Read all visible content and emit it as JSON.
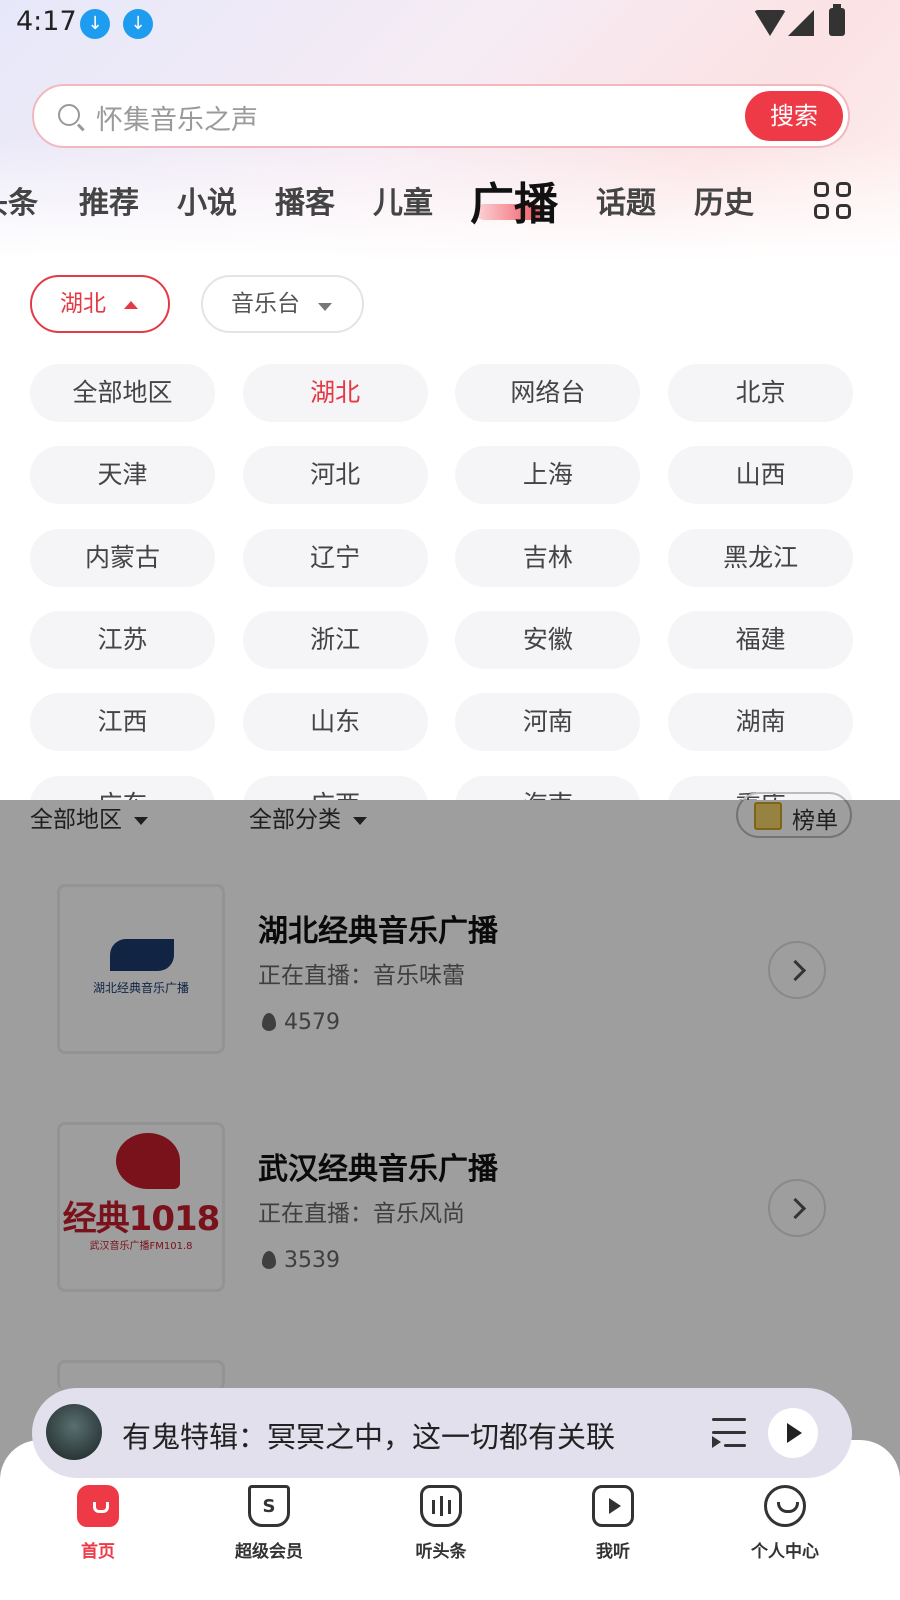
{
  "status_bar": {
    "time": "4:17"
  },
  "search": {
    "placeholder": "怀集音乐之声",
    "button": "搜索"
  },
  "tabs": [
    "头条",
    "推荐",
    "小说",
    "播客",
    "儿童",
    "广播",
    "话题",
    "历史"
  ],
  "active_tab": "广播",
  "filters": {
    "region": "湖北",
    "category": "音乐台"
  },
  "regions": [
    "全部地区",
    "湖北",
    "网络台",
    "北京",
    "天津",
    "河北",
    "上海",
    "山西",
    "内蒙古",
    "辽宁",
    "吉林",
    "黑龙江",
    "江苏",
    "浙江",
    "安徽",
    "福建",
    "江西",
    "山东",
    "河南",
    "湖南",
    "广东",
    "广西",
    "海南",
    "重庆"
  ],
  "selected_region": "湖北",
  "list_filters": {
    "region": "全部地区",
    "category": "全部分类",
    "rank": "榜单"
  },
  "stations": [
    {
      "title": "湖北经典音乐广播",
      "now_playing": "正在直播：音乐味蕾",
      "heat": "4579",
      "cover_text": "湖北经典音乐广播"
    },
    {
      "title": "武汉经典音乐广播",
      "now_playing": "正在直播：音乐风尚",
      "heat": "3539",
      "cover_text": "经典1018",
      "cover_sub": "武汉音乐广播FM101.8"
    }
  ],
  "player": {
    "title": "有鬼特辑：冥冥之中，这一切都有关联"
  },
  "nav": [
    {
      "label": "首页",
      "icon": "home-icon",
      "active": true
    },
    {
      "label": "超级会员",
      "icon": "vip-bag-icon"
    },
    {
      "label": "听头条",
      "icon": "headline-audio-icon"
    },
    {
      "label": "我听",
      "icon": "play-square-icon"
    },
    {
      "label": "个人中心",
      "icon": "smile-face-icon"
    }
  ],
  "colors": {
    "accent": "#ee3a47",
    "download": "#1e9cf0",
    "chip_bg": "#f5f5f7"
  }
}
